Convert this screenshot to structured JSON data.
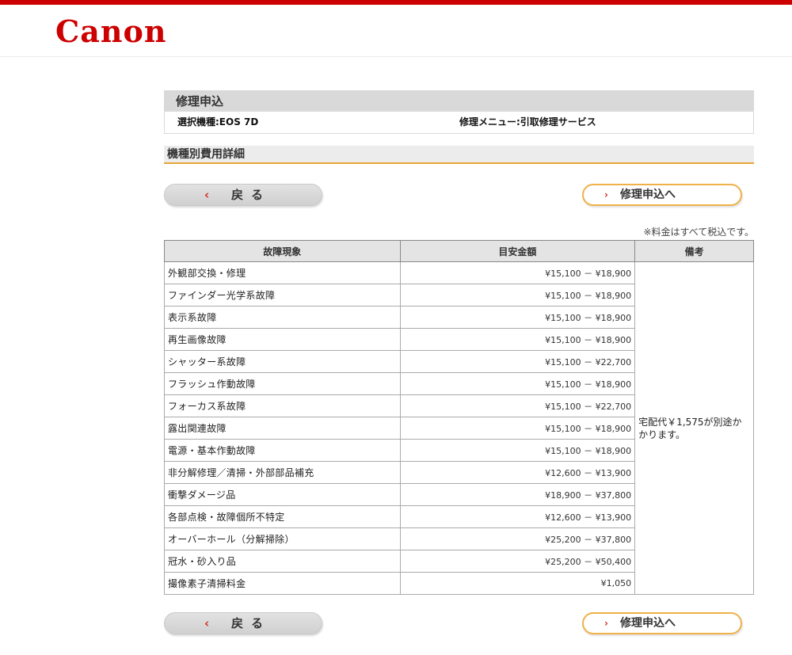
{
  "header": {
    "logo_text": "Canon",
    "brand_color": "#cc0000"
  },
  "section": {
    "title": "修理申込",
    "model": "選択機種:EOS 7D",
    "menu": "修理メニュー:引取修理サービス"
  },
  "detail_title": "機種別費用詳細",
  "buttons": {
    "back_icon": "‹",
    "back_label": "戻る",
    "apply_icon": "›",
    "apply_label": "修理申込へ"
  },
  "note": "※料金はすべて税込です。",
  "table": {
    "headers": [
      "故障現象",
      "目安金額",
      "備考"
    ],
    "rows": [
      {
        "symptom": "外観部交換・修理",
        "price": "¥15,100 － ¥18,900"
      },
      {
        "symptom": "ファインダー光学系故障",
        "price": "¥15,100 － ¥18,900"
      },
      {
        "symptom": "表示系故障",
        "price": "¥15,100 － ¥18,900"
      },
      {
        "symptom": "再生画像故障",
        "price": "¥15,100 － ¥18,900"
      },
      {
        "symptom": "シャッター系故障",
        "price": "¥15,100 － ¥22,700"
      },
      {
        "symptom": "フラッシュ作動故障",
        "price": "¥15,100 － ¥18,900"
      },
      {
        "symptom": "フォーカス系故障",
        "price": "¥15,100 － ¥22,700"
      },
      {
        "symptom": "露出関連故障",
        "price": "¥15,100 － ¥18,900"
      },
      {
        "symptom": "電源・基本作動故障",
        "price": "¥15,100 － ¥18,900"
      },
      {
        "symptom": "非分解修理／清掃・外部部品補充",
        "price": "¥12,600 － ¥13,900"
      },
      {
        "symptom": "衝撃ダメージ品",
        "price": "¥18,900 － ¥37,800"
      },
      {
        "symptom": "各部点検・故障個所不特定",
        "price": "¥12,600 － ¥13,900"
      },
      {
        "symptom": "オーバーホール（分解掃除）",
        "price": "¥25,200 － ¥37,800"
      },
      {
        "symptom": "冠水・砂入り品",
        "price": "¥25,200 － ¥50,400"
      },
      {
        "symptom": "撮像素子清掃料金",
        "price": "¥1,050"
      }
    ],
    "remark": "宅配代￥1,575が別途かかります。"
  }
}
